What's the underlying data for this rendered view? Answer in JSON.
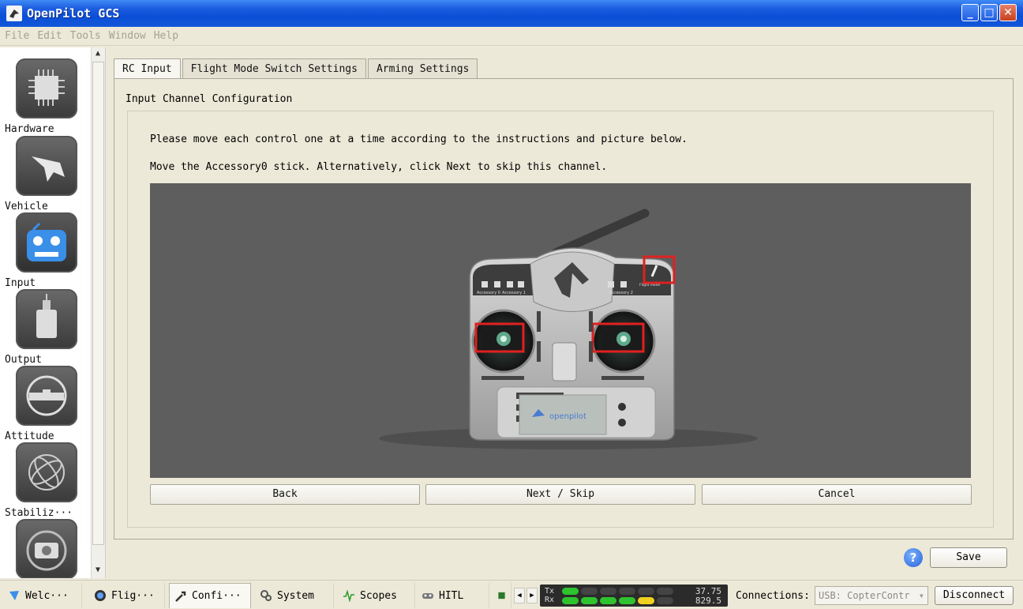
{
  "window": {
    "title": "OpenPilot GCS",
    "minimize": "_",
    "maximize": "□",
    "close": "✕"
  },
  "menu": [
    "File",
    "Edit",
    "Tools",
    "Window",
    "Help"
  ],
  "sidebar": {
    "items": [
      {
        "label": "Hardware",
        "icon": "chip-icon"
      },
      {
        "label": "Vehicle",
        "icon": "plane-icon"
      },
      {
        "label": "Input",
        "icon": "transmitter-icon"
      },
      {
        "label": "Output",
        "icon": "motor-icon"
      },
      {
        "label": "Attitude",
        "icon": "level-icon"
      },
      {
        "label": "Stabiliz···",
        "icon": "gyro-icon"
      },
      {
        "label": "",
        "icon": "camera-icon"
      }
    ]
  },
  "tabs": [
    "RC Input",
    "Flight Mode Switch Settings",
    "Arming Settings"
  ],
  "content": {
    "group_title": "Input Channel Configuration",
    "instruction_1": "Please move each control one at a time according to the instructions and picture below.",
    "instruction_2": "Move the Accessory0 stick. Alternatively, click Next to skip this channel.",
    "transmitter": {
      "labels": [
        "Accessory 0",
        "Accessory 1",
        "Accessory 2",
        "Flight Mode"
      ],
      "brand": "openpilot"
    },
    "buttons": {
      "back": "Back",
      "next": "Next / Skip",
      "cancel": "Cancel"
    }
  },
  "help": "?",
  "save": "Save",
  "modes": [
    {
      "label": "Welc···",
      "icon": "welcome-icon"
    },
    {
      "label": "Flig···",
      "icon": "flight-icon"
    },
    {
      "label": "Confi···",
      "icon": "wrench-icon"
    },
    {
      "label": "System",
      "icon": "gears-icon"
    },
    {
      "label": "Scopes",
      "icon": "scope-icon"
    },
    {
      "label": "HITL",
      "icon": "gamepad-icon"
    }
  ],
  "telemetry": {
    "tx_label": "Tx",
    "rx_label": "Rx",
    "tx_value": "37.75",
    "rx_value": "829.5"
  },
  "connection": {
    "label": "Connections:",
    "selected": "USB: CopterContr",
    "disconnect": "Disconnect"
  },
  "colors": {
    "titlebar": "#0b4ed6",
    "stage": "#5e5e5e",
    "highlight": "#e02020",
    "signal_ok": "#2ec22e",
    "signal_warn": "#f0d020"
  }
}
